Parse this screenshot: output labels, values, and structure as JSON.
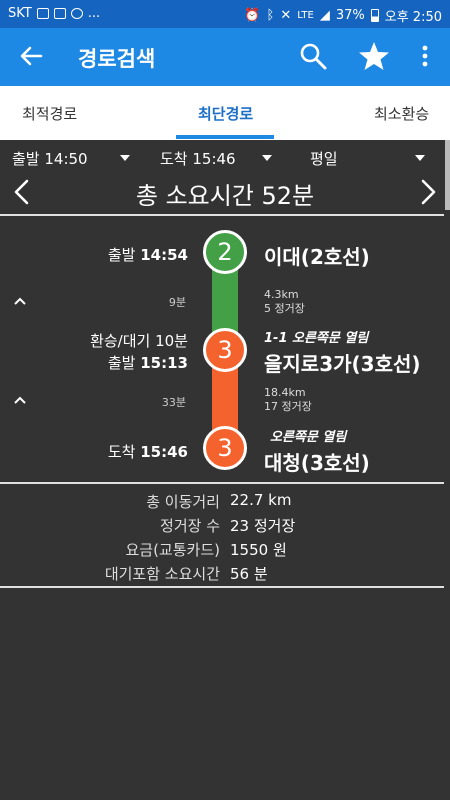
{
  "status_bar": {
    "carrier": "SKT",
    "right_text": "LTE",
    "battery": "37%",
    "time": "오후 2:50"
  },
  "app_bar": {
    "title": "경로검색",
    "icons": [
      "back-arrow-icon",
      "search-icon",
      "star-icon",
      "more-vert-icon"
    ]
  },
  "tabs": [
    {
      "label": "최적경로",
      "selected": false
    },
    {
      "label": "최단경로",
      "selected": true
    },
    {
      "label": "최소환승",
      "selected": false
    }
  ],
  "selectors": {
    "depart": "출발 14:50",
    "arrive": "도착 15:46",
    "day": "평일"
  },
  "summary_header": {
    "total_time": "총 소요시간 52분"
  },
  "route": {
    "stop1": {
      "label_prefix": "출발 ",
      "label_time": "14:54",
      "line_number": "2",
      "station": "이대(2호선)",
      "color": "#43a047"
    },
    "seg1": {
      "duration": "9분",
      "distance": "4.3km",
      "stops": "5 정거장",
      "color": "#43a047"
    },
    "stop2": {
      "transfer": "환승/대기 10분",
      "label_prefix": "출발 ",
      "label_time": "15:13",
      "door": "1-1  오른쪽문 열림",
      "line_number": "3",
      "station": "을지로3가(3호선)",
      "color": "#f4622d"
    },
    "seg2": {
      "duration": "33분",
      "distance": "18.4km",
      "stops": "17 정거장",
      "color": "#f4622d"
    },
    "stop3": {
      "label_prefix": "도착 ",
      "label_time": "15:46",
      "door": "오른쪽문 열림",
      "line_number": "3",
      "station": "대청(3호선)",
      "color": "#f4622d"
    }
  },
  "summary": [
    {
      "label": "총 이동거리",
      "value": "22.7 km"
    },
    {
      "label": "정거장 수",
      "value": "23 정거장"
    },
    {
      "label": "요금(교통카드)",
      "value": "1550 원"
    },
    {
      "label": "대기포함 소요시간",
      "value": "56 분"
    }
  ],
  "colors": {
    "status_bar": "#1565c0",
    "app_bar": "#1e88e5",
    "background": "#333333",
    "line2": "#43a047",
    "line3": "#f4622d"
  }
}
